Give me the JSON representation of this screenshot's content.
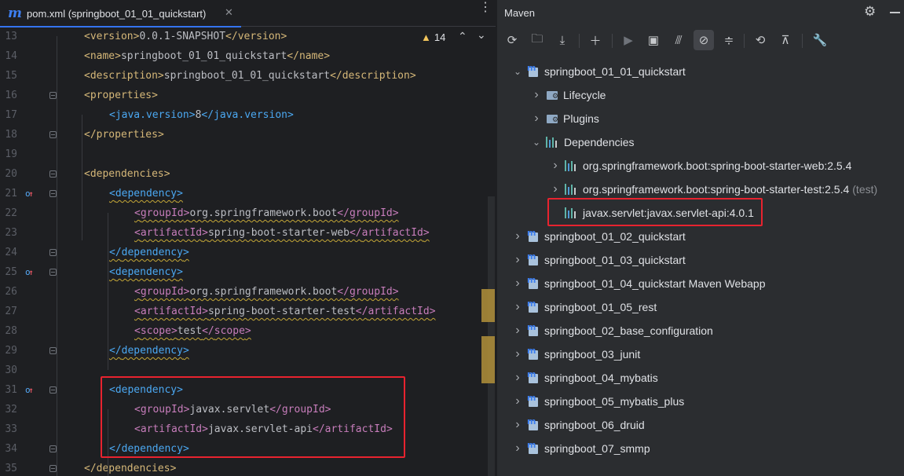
{
  "editor": {
    "tab_title": "pom.xml (springboot_01_01_quickstart)",
    "warning_count": "14",
    "lines": [
      {
        "n": "13",
        "indent": 1,
        "parts": [
          [
            "t",
            "<"
          ],
          [
            "t",
            "version"
          ],
          [
            "t",
            ">"
          ],
          [
            "v",
            "0.0.1-SNAPSHOT"
          ],
          [
            "t",
            "</"
          ],
          [
            "t",
            "version"
          ],
          [
            "t",
            ">"
          ]
        ]
      },
      {
        "n": "14",
        "indent": 1,
        "parts": [
          [
            "t",
            "<"
          ],
          [
            "t",
            "name"
          ],
          [
            "t",
            ">"
          ],
          [
            "v",
            "springboot_01_01_quickstart"
          ],
          [
            "t",
            "</"
          ],
          [
            "t",
            "name"
          ],
          [
            "t",
            ">"
          ]
        ]
      },
      {
        "n": "15",
        "indent": 1,
        "parts": [
          [
            "t",
            "<"
          ],
          [
            "t",
            "description"
          ],
          [
            "t",
            ">"
          ],
          [
            "v",
            "springboot_01_01_quickstart"
          ],
          [
            "t",
            "</"
          ],
          [
            "t",
            "description"
          ],
          [
            "t",
            ">"
          ]
        ]
      },
      {
        "n": "16",
        "indent": 1,
        "parts": [
          [
            "t",
            "<"
          ],
          [
            "t",
            "properties"
          ],
          [
            "t",
            ">"
          ]
        ]
      },
      {
        "n": "17",
        "indent": 2,
        "parts": [
          [
            "t",
            "<"
          ],
          [
            "t",
            "java.version"
          ],
          [
            "t",
            ">"
          ],
          [
            "v",
            "8"
          ],
          [
            "t",
            "</"
          ],
          [
            "t",
            "java.version"
          ],
          [
            "t",
            ">"
          ]
        ]
      },
      {
        "n": "18",
        "indent": 1,
        "parts": [
          [
            "t",
            "</"
          ],
          [
            "t",
            "properties"
          ],
          [
            "t",
            ">"
          ]
        ]
      },
      {
        "n": "19",
        "indent": 0,
        "parts": []
      },
      {
        "n": "20",
        "indent": 1,
        "parts": [
          [
            "t",
            "<"
          ],
          [
            "t",
            "dependencies"
          ],
          [
            "t",
            ">"
          ]
        ]
      },
      {
        "n": "21",
        "indent": 2,
        "parts": [
          [
            "t",
            "<"
          ],
          [
            "t",
            "dependency"
          ],
          [
            "t",
            ">"
          ]
        ]
      },
      {
        "n": "22",
        "indent": 3,
        "parts": [
          [
            "t",
            "<"
          ],
          [
            "t",
            "groupId"
          ],
          [
            "t",
            ">"
          ],
          [
            "v",
            "org.springframework.boot"
          ],
          [
            "t",
            "</"
          ],
          [
            "t",
            "groupId"
          ],
          [
            "t",
            ">"
          ]
        ]
      },
      {
        "n": "23",
        "indent": 3,
        "parts": [
          [
            "t",
            "<"
          ],
          [
            "t",
            "artifactId"
          ],
          [
            "t",
            ">"
          ],
          [
            "v",
            "spring-boot-starter-web"
          ],
          [
            "t",
            "</"
          ],
          [
            "t",
            "artifactId"
          ],
          [
            "t",
            ">"
          ]
        ]
      },
      {
        "n": "24",
        "indent": 2,
        "parts": [
          [
            "t",
            "</"
          ],
          [
            "t",
            "dependency"
          ],
          [
            "t",
            ">"
          ]
        ]
      },
      {
        "n": "25",
        "indent": 2,
        "parts": [
          [
            "t",
            "<"
          ],
          [
            "t",
            "dependency"
          ],
          [
            "t",
            ">"
          ]
        ]
      },
      {
        "n": "26",
        "indent": 3,
        "parts": [
          [
            "t",
            "<"
          ],
          [
            "t",
            "groupId"
          ],
          [
            "t",
            ">"
          ],
          [
            "v",
            "org.springframework.boot"
          ],
          [
            "t",
            "</"
          ],
          [
            "t",
            "groupId"
          ],
          [
            "t",
            ">"
          ]
        ]
      },
      {
        "n": "27",
        "indent": 3,
        "parts": [
          [
            "t",
            "<"
          ],
          [
            "t",
            "artifactId"
          ],
          [
            "t",
            ">"
          ],
          [
            "v",
            "spring-boot-starter-test"
          ],
          [
            "t",
            "</"
          ],
          [
            "t",
            "artifactId"
          ],
          [
            "t",
            ">"
          ]
        ]
      },
      {
        "n": "28",
        "indent": 3,
        "parts": [
          [
            "t",
            "<"
          ],
          [
            "t",
            "scope"
          ],
          [
            "t",
            ">"
          ],
          [
            "v",
            "test"
          ],
          [
            "t",
            "</"
          ],
          [
            "t",
            "scope"
          ],
          [
            "t",
            ">"
          ]
        ]
      },
      {
        "n": "29",
        "indent": 2,
        "parts": [
          [
            "t",
            "</"
          ],
          [
            "t",
            "dependency"
          ],
          [
            "t",
            ">"
          ]
        ]
      },
      {
        "n": "30",
        "indent": 0,
        "parts": []
      },
      {
        "n": "31",
        "indent": 2,
        "parts": [
          [
            "t",
            "<"
          ],
          [
            "t",
            "dependency"
          ],
          [
            "t",
            ">"
          ]
        ]
      },
      {
        "n": "32",
        "indent": 3,
        "parts": [
          [
            "t",
            "<"
          ],
          [
            "t",
            "groupId"
          ],
          [
            "t",
            ">"
          ],
          [
            "v",
            "javax.servlet"
          ],
          [
            "t",
            "</"
          ],
          [
            "t",
            "groupId"
          ],
          [
            "t",
            ">"
          ]
        ]
      },
      {
        "n": "33",
        "indent": 3,
        "parts": [
          [
            "t",
            "<"
          ],
          [
            "t",
            "artifactId"
          ],
          [
            "t",
            ">"
          ],
          [
            "v",
            "javax.servlet-api"
          ],
          [
            "t",
            "</"
          ],
          [
            "t",
            "artifactId"
          ],
          [
            "t",
            ">"
          ]
        ]
      },
      {
        "n": "34",
        "indent": 2,
        "parts": [
          [
            "t",
            "</"
          ],
          [
            "t",
            "dependency"
          ],
          [
            "t",
            ">"
          ]
        ]
      },
      {
        "n": "35",
        "indent": 1,
        "parts": [
          [
            "t",
            "</"
          ],
          [
            "t",
            "dependencies"
          ],
          [
            "t",
            ">"
          ]
        ]
      }
    ]
  },
  "maven": {
    "title": "Maven",
    "toolbar_icons": [
      "reload-icon",
      "add-folder-icon",
      "download-icon",
      "plus-icon",
      "run-icon",
      "execute-goal-icon",
      "toggle-offline-icon",
      "skip-tests-icon",
      "collapse-icon",
      "lifecycle-icon",
      "show-deps-icon",
      "settings-wrench-icon"
    ],
    "tree": [
      {
        "label": "springboot_01_01_quickstart",
        "depth": 0,
        "expanded": true,
        "icon": "maven-module-icon"
      },
      {
        "label": "Lifecycle",
        "depth": 1,
        "expanded": false,
        "icon": "folder-gear-icon"
      },
      {
        "label": "Plugins",
        "depth": 1,
        "expanded": false,
        "icon": "folder-gear-icon"
      },
      {
        "label": "Dependencies",
        "depth": 1,
        "expanded": true,
        "icon": "dependencies-icon"
      },
      {
        "label": "org.springframework.boot:spring-boot-starter-web:2.5.4",
        "depth": 2,
        "expanded": false,
        "icon": "library-icon"
      },
      {
        "label": "org.springframework.boot:spring-boot-starter-test:2.5.4",
        "suffix": "(test)",
        "depth": 2,
        "expanded": false,
        "icon": "library-icon"
      },
      {
        "label": "javax.servlet:javax.servlet-api:4.0.1",
        "depth": 2,
        "leaf": true,
        "icon": "library-icon"
      },
      {
        "label": "springboot_01_02_quickstart",
        "depth": 0,
        "expanded": false,
        "icon": "maven-module-icon"
      },
      {
        "label": "springboot_01_03_quickstart",
        "depth": 0,
        "expanded": false,
        "icon": "maven-module-icon"
      },
      {
        "label": "springboot_01_04_quickstart Maven Webapp",
        "depth": 0,
        "expanded": false,
        "icon": "maven-module-icon"
      },
      {
        "label": "springboot_01_05_rest",
        "depth": 0,
        "expanded": false,
        "icon": "maven-module-icon"
      },
      {
        "label": "springboot_02_base_configuration",
        "depth": 0,
        "expanded": false,
        "icon": "maven-module-icon"
      },
      {
        "label": "springboot_03_junit",
        "depth": 0,
        "expanded": false,
        "icon": "maven-module-icon"
      },
      {
        "label": "springboot_04_mybatis",
        "depth": 0,
        "expanded": false,
        "icon": "maven-module-icon"
      },
      {
        "label": "springboot_05_mybatis_plus",
        "depth": 0,
        "expanded": false,
        "icon": "maven-module-icon"
      },
      {
        "label": "springboot_06_druid",
        "depth": 0,
        "expanded": false,
        "icon": "maven-module-icon"
      },
      {
        "label": "springboot_07_smmp",
        "depth": 0,
        "expanded": false,
        "icon": "maven-module-icon"
      }
    ]
  },
  "colors": {
    "highlight_box": "#e8232f",
    "accent": "#3574f0"
  }
}
